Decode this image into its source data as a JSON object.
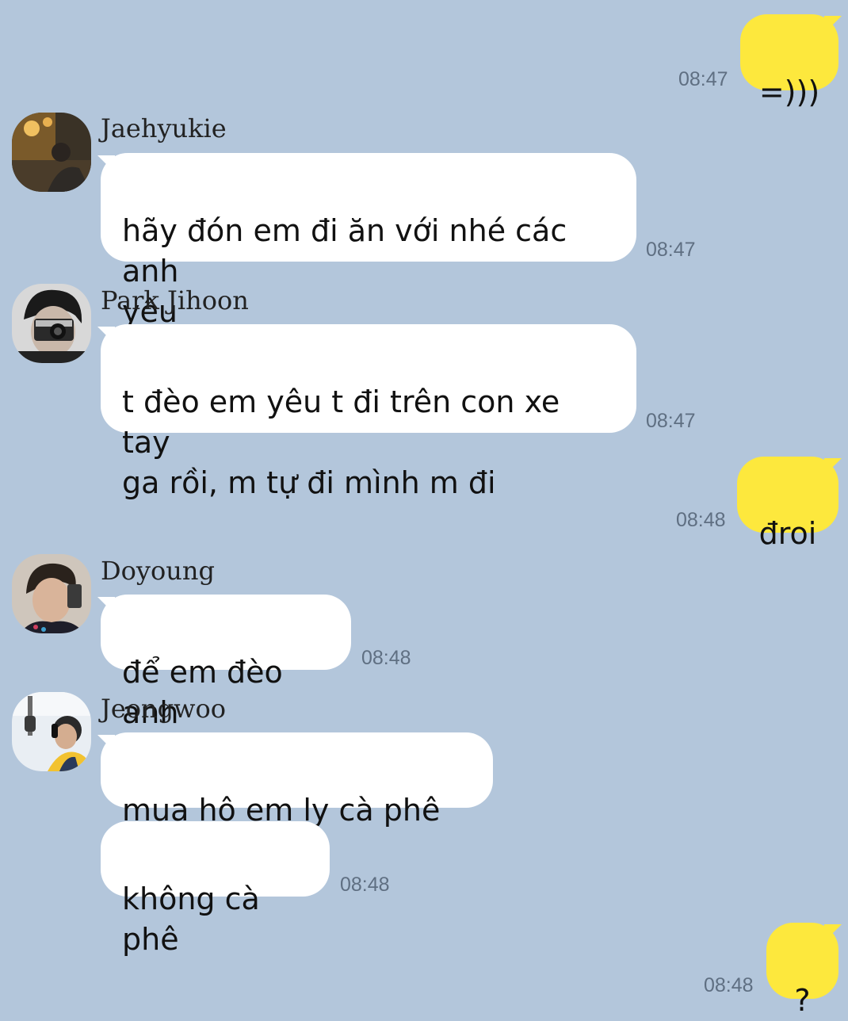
{
  "chat": {
    "messages": [
      {
        "side": "out",
        "text": "=)))",
        "time": "08:47"
      },
      {
        "side": "in",
        "sender": "Jaehyukie",
        "text": "hãy đón em đi ăn với nhé các anh\nyêu",
        "emoji": "❤",
        "time": "08:47"
      },
      {
        "side": "in",
        "sender": "Park Jihoon",
        "text": "t đèo em yêu t đi trên con xe tay\nga rồi, m tự đi mình m đi",
        "time": "08:47"
      },
      {
        "side": "out",
        "text": "đroi",
        "time": "08:48"
      },
      {
        "side": "in",
        "sender": "Doyoung",
        "text": "để em đèo anh",
        "time": "08:48"
      },
      {
        "side": "in",
        "sender": "Jeongwoo",
        "text": "mua hộ em ly cà phê sữa",
        "time": ""
      },
      {
        "side": "in",
        "sender": "",
        "text": "không cà phê",
        "time": "08:48"
      },
      {
        "side": "out",
        "text": "?",
        "time": "08:48"
      }
    ]
  },
  "colors": {
    "background": "#b3c6db",
    "incoming_bubble": "#ffffff",
    "outgoing_bubble": "#fde83d",
    "timestamp": "#5f6f82"
  },
  "icons": [
    "avatar-jaehyukie",
    "avatar-park-jihoon",
    "avatar-doyoung",
    "avatar-jeongwoo",
    "heart-emoji"
  ]
}
